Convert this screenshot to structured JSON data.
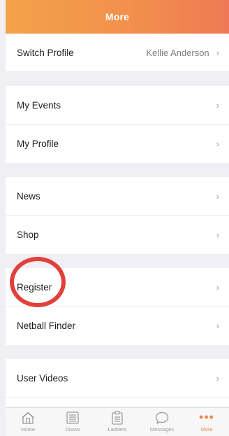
{
  "header": {
    "title": "More"
  },
  "menu": {
    "switch_profile": {
      "label": "Switch Profile",
      "value": "Kellie Anderson"
    },
    "my_events": "My Events",
    "my_profile": "My Profile",
    "news": "News",
    "shop": "Shop",
    "register": "Register",
    "netball_finder": "Netball Finder",
    "user_videos": "User Videos",
    "chevron": "›"
  },
  "tabs": [
    {
      "label": "Home",
      "icon": "home-icon"
    },
    {
      "label": "Draws",
      "icon": "draws-icon"
    },
    {
      "label": "Ladders",
      "icon": "ladders-icon"
    },
    {
      "label": "Messages",
      "icon": "messages-icon"
    },
    {
      "label": "More",
      "icon": "more-icon"
    }
  ],
  "colors": {
    "accent": "#f08a4b",
    "annotation_circle": "#e2403a"
  }
}
